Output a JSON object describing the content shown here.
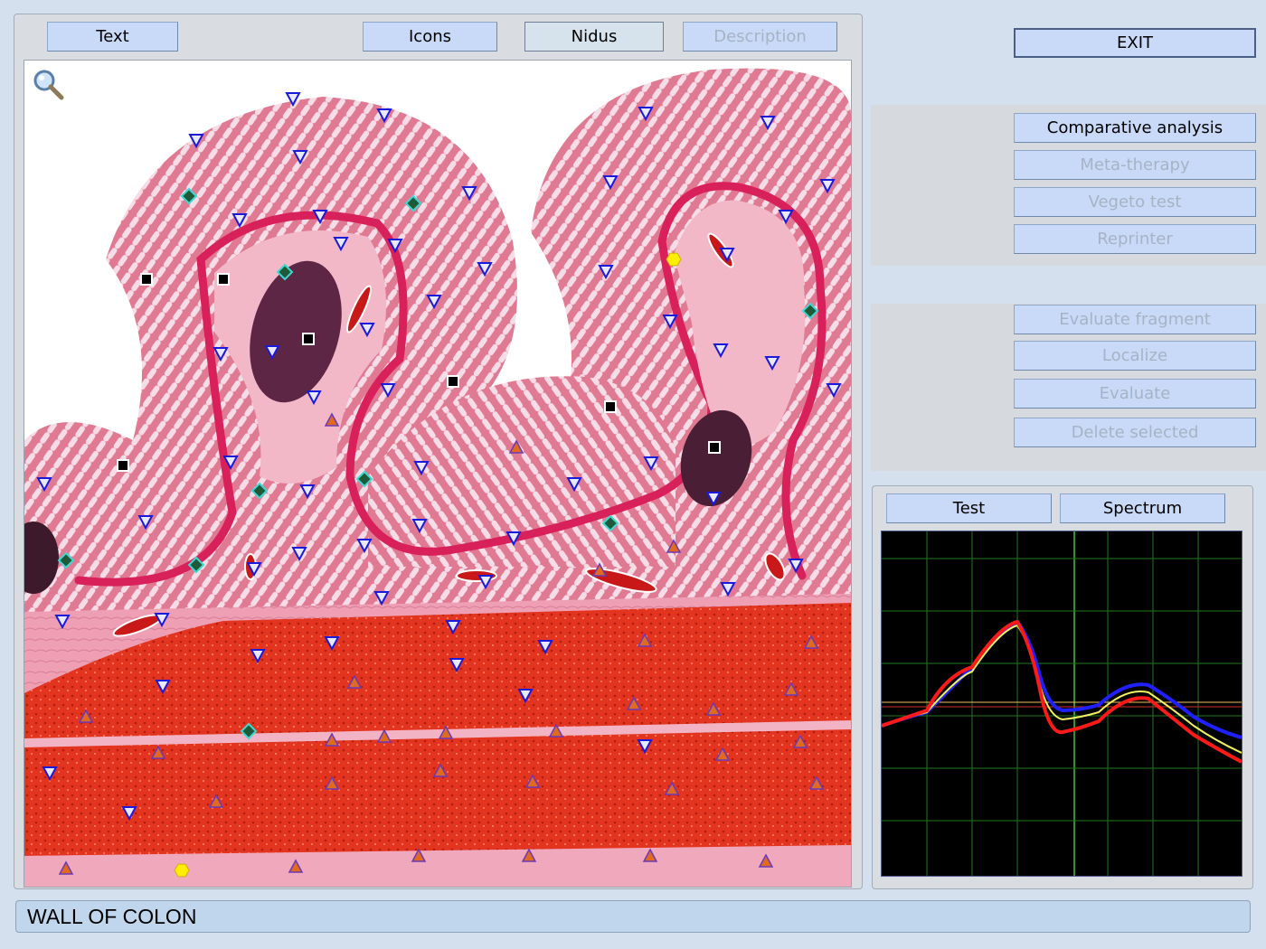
{
  "toolbar": {
    "text_label": "Text",
    "icons_label": "Icons",
    "nidus_label": "Nidus",
    "description_label": "Description"
  },
  "exit_label": "EXIT",
  "analysis_menu": {
    "comparative_analysis": "Comparative analysis",
    "meta_therapy": "Meta-therapy",
    "vegeto_test": "Vegeto test",
    "reprinter": "Reprinter"
  },
  "fragment_menu": {
    "evaluate_fragment": "Evaluate fragment",
    "localize": "Localize",
    "evaluate": "Evaluate",
    "delete_selected": "Delete selected"
  },
  "chart_tabs": {
    "test": "Test",
    "spectrum": "Spectrum"
  },
  "status": {
    "title": "WALL OF COLON"
  },
  "icons": {
    "zoom": "magnifier-icon",
    "marker_types": [
      "blue-triangle-down-marker",
      "orange-triangle-up-marker",
      "teal-diamond-marker",
      "black-square-marker",
      "yellow-hexagon-marker"
    ]
  },
  "colors": {
    "button_bg": "#c8daf8",
    "disabled_text": "#a6b3c4",
    "marker_blue": "#1a1adb",
    "marker_orange": "#e06a20",
    "marker_teal": "#3fd8d0",
    "marker_yellow": "#ffee00",
    "curve_red": "#ff1a1a",
    "curve_blue": "#2020ff",
    "curve_yellow": "#f0f060",
    "grid_green": "#1e7a1e"
  }
}
